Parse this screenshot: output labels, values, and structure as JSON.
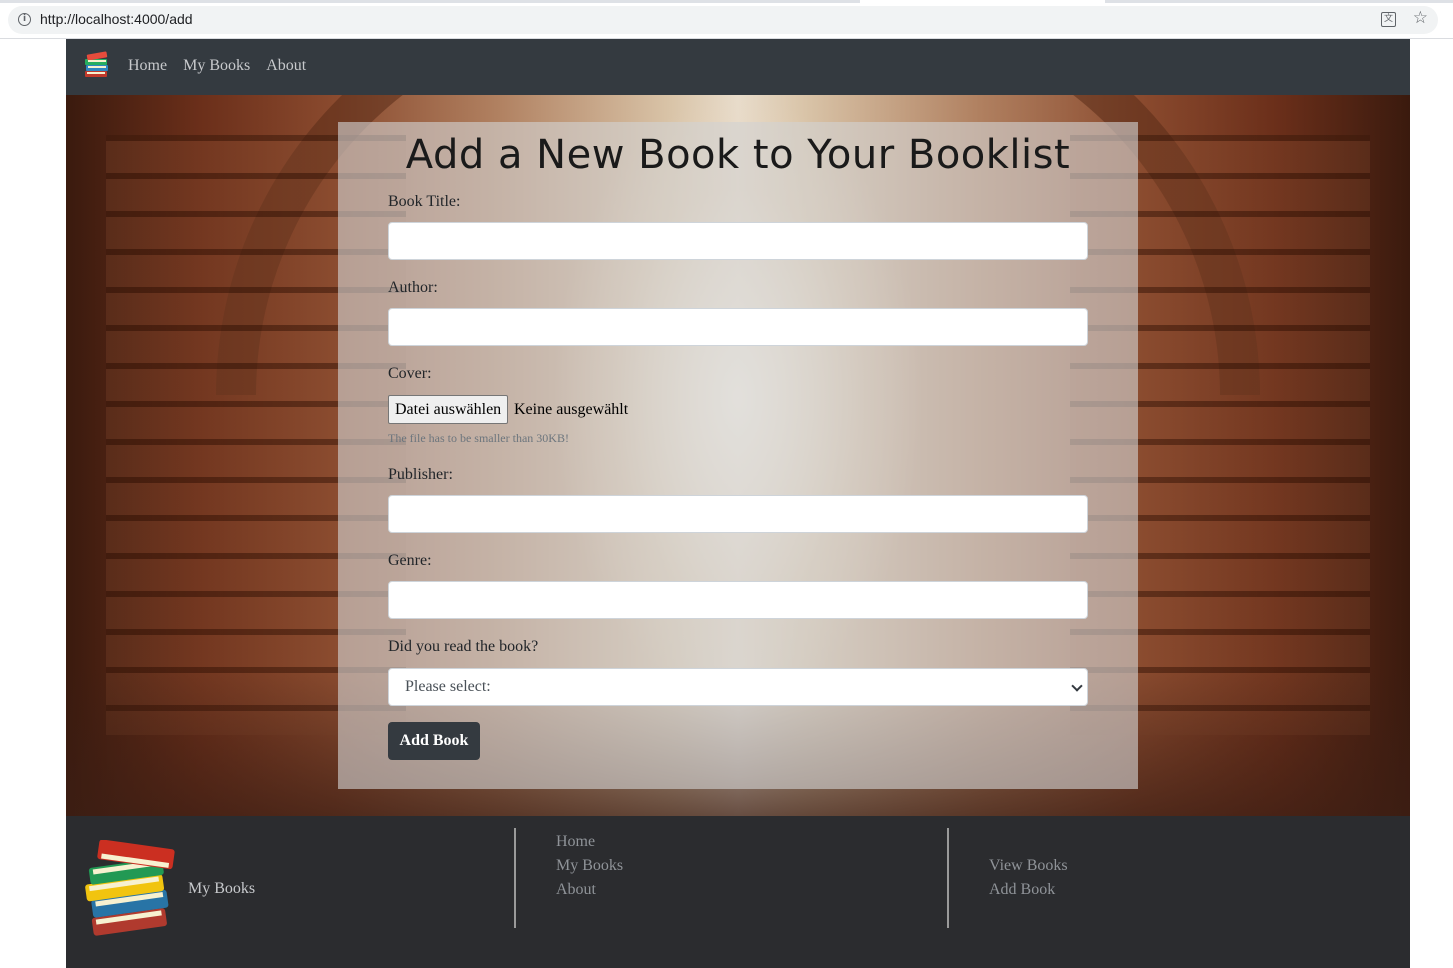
{
  "browser": {
    "url": "http://localhost:4000/add",
    "info_icon": "info-icon",
    "translate_icon": "translate-icon",
    "bookmark_icon": "star-icon"
  },
  "navbar": {
    "logo_icon": "book-stack-icon",
    "links": [
      "Home",
      "My Books",
      "About"
    ]
  },
  "form": {
    "title": "Add a New Book to Your Booklist",
    "book_title_label": "Book Title:",
    "author_label": "Author:",
    "cover_label": "Cover:",
    "file_button": "Datei auswählen",
    "file_status": "Keine ausgewählt",
    "file_help": "The file has to be smaller than 30KB!",
    "publisher_label": "Publisher:",
    "genre_label": "Genre:",
    "read_label": "Did you read the book?",
    "read_select_value": "Please select:",
    "submit_label": "Add Book"
  },
  "footer": {
    "brand": "My Books",
    "nav_links": [
      "Home",
      "My Books",
      "About"
    ],
    "book_links": [
      "View Books",
      "Add Book"
    ]
  },
  "colors": {
    "navbar_bg": "#343a40",
    "footer_bg": "#2b2c2f",
    "button_bg": "#343a40"
  }
}
